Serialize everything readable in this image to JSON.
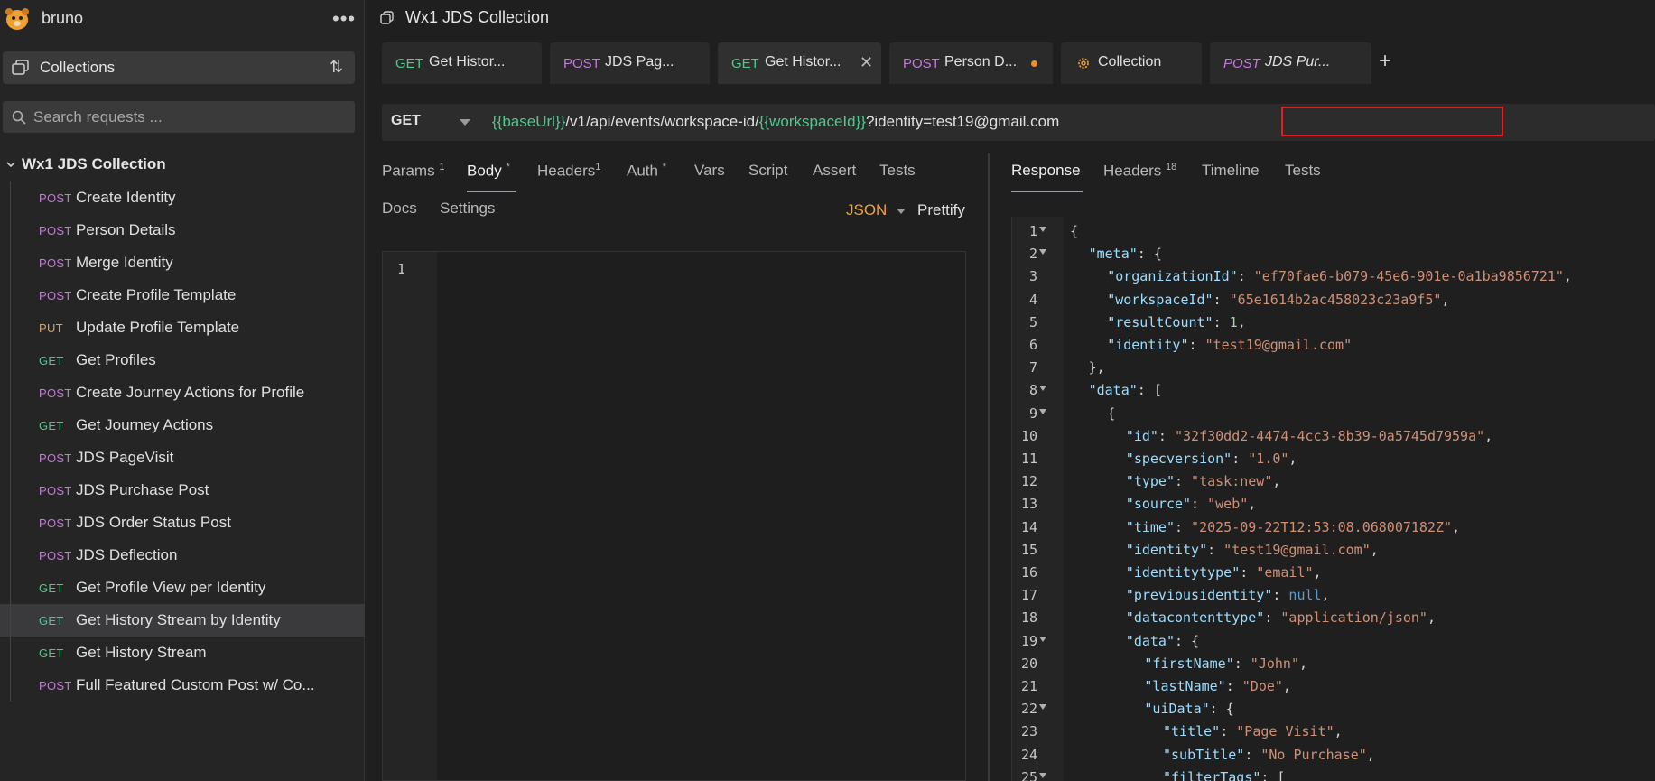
{
  "app": {
    "name": "bruno",
    "more_label": "•••"
  },
  "sidebar": {
    "collections_label": "Collections",
    "sort_label": "⇅",
    "search_placeholder": "Search requests ...",
    "collection_name": "Wx1 JDS Collection",
    "requests": [
      {
        "method": "POST",
        "name": "Create Identity"
      },
      {
        "method": "POST",
        "name": "Person Details"
      },
      {
        "method": "POST",
        "name": "Merge Identity"
      },
      {
        "method": "POST",
        "name": "Create Profile Template"
      },
      {
        "method": "PUT",
        "name": "Update Profile Template"
      },
      {
        "method": "GET",
        "name": "Get Profiles"
      },
      {
        "method": "POST",
        "name": "Create Journey Actions for Profile"
      },
      {
        "method": "GET",
        "name": "Get Journey Actions"
      },
      {
        "method": "POST",
        "name": "JDS PageVisit"
      },
      {
        "method": "POST",
        "name": "JDS Purchase Post"
      },
      {
        "method": "POST",
        "name": "JDS Order Status Post"
      },
      {
        "method": "POST",
        "name": "JDS Deflection"
      },
      {
        "method": "GET",
        "name": "Get Profile View per Identity"
      },
      {
        "method": "GET",
        "name": "Get History Stream by Identity",
        "active": true
      },
      {
        "method": "GET",
        "name": "Get History Stream"
      },
      {
        "method": "POST",
        "name": "Full Featured Custom Post w/ Co..."
      }
    ]
  },
  "header": {
    "title": "Wx1 JDS Collection"
  },
  "tabs": [
    {
      "method": "GET",
      "name": "Get Histor..."
    },
    {
      "method": "POST",
      "name": "JDS Pag..."
    },
    {
      "method": "GET",
      "name": "Get Histor...",
      "active": true,
      "close": "✕"
    },
    {
      "method": "POST",
      "name": "Person D...",
      "unsaved": true
    },
    {
      "method": "",
      "name": "Collection"
    },
    {
      "method": "POST",
      "name": "JDS Pur...",
      "italic": true
    }
  ],
  "add_tab_label": "+",
  "request": {
    "method": "GET",
    "url_parts": {
      "base_var": "{{baseUrl}}",
      "path": "/v1/api/events/workspace-id/",
      "workspace_var": "{{workspaceId}}",
      "query": "?identity=test19@gmail.com"
    },
    "tabs": {
      "params": "Params",
      "params_count": "1",
      "body": "Body",
      "body_mark": "*",
      "headers": "Headers",
      "headers_count": "1",
      "auth": "Auth",
      "auth_mark": "*",
      "vars": "Vars",
      "script": "Script",
      "assert": "Assert",
      "tests": "Tests",
      "docs": "Docs",
      "settings": "Settings"
    },
    "body_mode": "JSON",
    "prettify_label": "Prettify",
    "editor_line": "1"
  },
  "response": {
    "tabs": {
      "response": "Response",
      "headers": "Headers",
      "headers_count": "18",
      "timeline": "Timeline",
      "tests": "Tests"
    },
    "lines": [
      {
        "n": "1",
        "fold": true,
        "indent": 0,
        "tokens": [
          [
            "p",
            "{"
          ]
        ]
      },
      {
        "n": "2",
        "fold": true,
        "indent": 1,
        "tokens": [
          [
            "k",
            "\"meta\""
          ],
          [
            "p",
            ": {"
          ]
        ]
      },
      {
        "n": "3",
        "indent": 2,
        "tokens": [
          [
            "k",
            "\"organizationId\""
          ],
          [
            "p",
            ": "
          ],
          [
            "s",
            "\"ef70fae6-b079-45e6-901e-0a1ba9856721\""
          ],
          [
            "p",
            ","
          ]
        ]
      },
      {
        "n": "4",
        "indent": 2,
        "tokens": [
          [
            "k",
            "\"workspaceId\""
          ],
          [
            "p",
            ": "
          ],
          [
            "s",
            "\"65e1614b2ac458023c23a9f5\""
          ],
          [
            "p",
            ","
          ]
        ]
      },
      {
        "n": "5",
        "indent": 2,
        "tokens": [
          [
            "k",
            "\"resultCount\""
          ],
          [
            "p",
            ": "
          ],
          [
            "nm",
            "1"
          ],
          [
            "p",
            ","
          ]
        ]
      },
      {
        "n": "6",
        "indent": 2,
        "tokens": [
          [
            "k",
            "\"identity\""
          ],
          [
            "p",
            ": "
          ],
          [
            "s",
            "\"test19@gmail.com\""
          ]
        ]
      },
      {
        "n": "7",
        "indent": 1,
        "tokens": [
          [
            "p",
            "},"
          ]
        ]
      },
      {
        "n": "8",
        "fold": true,
        "indent": 1,
        "tokens": [
          [
            "k",
            "\"data\""
          ],
          [
            "p",
            ": ["
          ]
        ]
      },
      {
        "n": "9",
        "fold": true,
        "indent": 2,
        "tokens": [
          [
            "p",
            "{"
          ]
        ]
      },
      {
        "n": "10",
        "indent": 3,
        "tokens": [
          [
            "k",
            "\"id\""
          ],
          [
            "p",
            ": "
          ],
          [
            "s",
            "\"32f30dd2-4474-4cc3-8b39-0a5745d7959a\""
          ],
          [
            "p",
            ","
          ]
        ]
      },
      {
        "n": "11",
        "indent": 3,
        "tokens": [
          [
            "k",
            "\"specversion\""
          ],
          [
            "p",
            ": "
          ],
          [
            "s",
            "\"1.0\""
          ],
          [
            "p",
            ","
          ]
        ]
      },
      {
        "n": "12",
        "indent": 3,
        "tokens": [
          [
            "k",
            "\"type\""
          ],
          [
            "p",
            ": "
          ],
          [
            "s",
            "\"task:new\""
          ],
          [
            "p",
            ","
          ]
        ]
      },
      {
        "n": "13",
        "indent": 3,
        "tokens": [
          [
            "k",
            "\"source\""
          ],
          [
            "p",
            ": "
          ],
          [
            "s",
            "\"web\""
          ],
          [
            "p",
            ","
          ]
        ]
      },
      {
        "n": "14",
        "indent": 3,
        "tokens": [
          [
            "k",
            "\"time\""
          ],
          [
            "p",
            ": "
          ],
          [
            "s",
            "\"2025-09-22T12:53:08.068007182Z\""
          ],
          [
            "p",
            ","
          ]
        ]
      },
      {
        "n": "15",
        "indent": 3,
        "tokens": [
          [
            "k",
            "\"identity\""
          ],
          [
            "p",
            ": "
          ],
          [
            "s",
            "\"test19@gmail.com\""
          ],
          [
            "p",
            ","
          ]
        ]
      },
      {
        "n": "16",
        "indent": 3,
        "tokens": [
          [
            "k",
            "\"identitytype\""
          ],
          [
            "p",
            ": "
          ],
          [
            "s",
            "\"email\""
          ],
          [
            "p",
            ","
          ]
        ]
      },
      {
        "n": "17",
        "indent": 3,
        "tokens": [
          [
            "k",
            "\"previousidentity\""
          ],
          [
            "p",
            ": "
          ],
          [
            "nl",
            "null"
          ],
          [
            "p",
            ","
          ]
        ]
      },
      {
        "n": "18",
        "indent": 3,
        "tokens": [
          [
            "k",
            "\"datacontenttype\""
          ],
          [
            "p",
            ": "
          ],
          [
            "s",
            "\"application/json\""
          ],
          [
            "p",
            ","
          ]
        ]
      },
      {
        "n": "19",
        "fold": true,
        "indent": 3,
        "tokens": [
          [
            "k",
            "\"data\""
          ],
          [
            "p",
            ": {"
          ]
        ]
      },
      {
        "n": "20",
        "indent": 4,
        "tokens": [
          [
            "k",
            "\"firstName\""
          ],
          [
            "p",
            ": "
          ],
          [
            "s",
            "\"John\""
          ],
          [
            "p",
            ","
          ]
        ]
      },
      {
        "n": "21",
        "indent": 4,
        "tokens": [
          [
            "k",
            "\"lastName\""
          ],
          [
            "p",
            ": "
          ],
          [
            "s",
            "\"Doe\""
          ],
          [
            "p",
            ","
          ]
        ]
      },
      {
        "n": "22",
        "fold": true,
        "indent": 4,
        "tokens": [
          [
            "k",
            "\"uiData\""
          ],
          [
            "p",
            ": {"
          ]
        ]
      },
      {
        "n": "23",
        "indent": 5,
        "tokens": [
          [
            "k",
            "\"title\""
          ],
          [
            "p",
            ": "
          ],
          [
            "s",
            "\"Page Visit\""
          ],
          [
            "p",
            ","
          ]
        ]
      },
      {
        "n": "24",
        "indent": 5,
        "tokens": [
          [
            "k",
            "\"subTitle\""
          ],
          [
            "p",
            ": "
          ],
          [
            "s",
            "\"No Purchase\""
          ],
          [
            "p",
            ","
          ]
        ]
      },
      {
        "n": "25",
        "fold": true,
        "indent": 5,
        "tokens": [
          [
            "k",
            "\"filterTags\""
          ],
          [
            "p",
            ": ["
          ]
        ]
      }
    ]
  },
  "colors": {
    "get": "#4ec98c",
    "post": "#c678dd",
    "put": "#e0a060",
    "highlight": "#e02020",
    "unsaved_dot": "#f08c2b"
  }
}
